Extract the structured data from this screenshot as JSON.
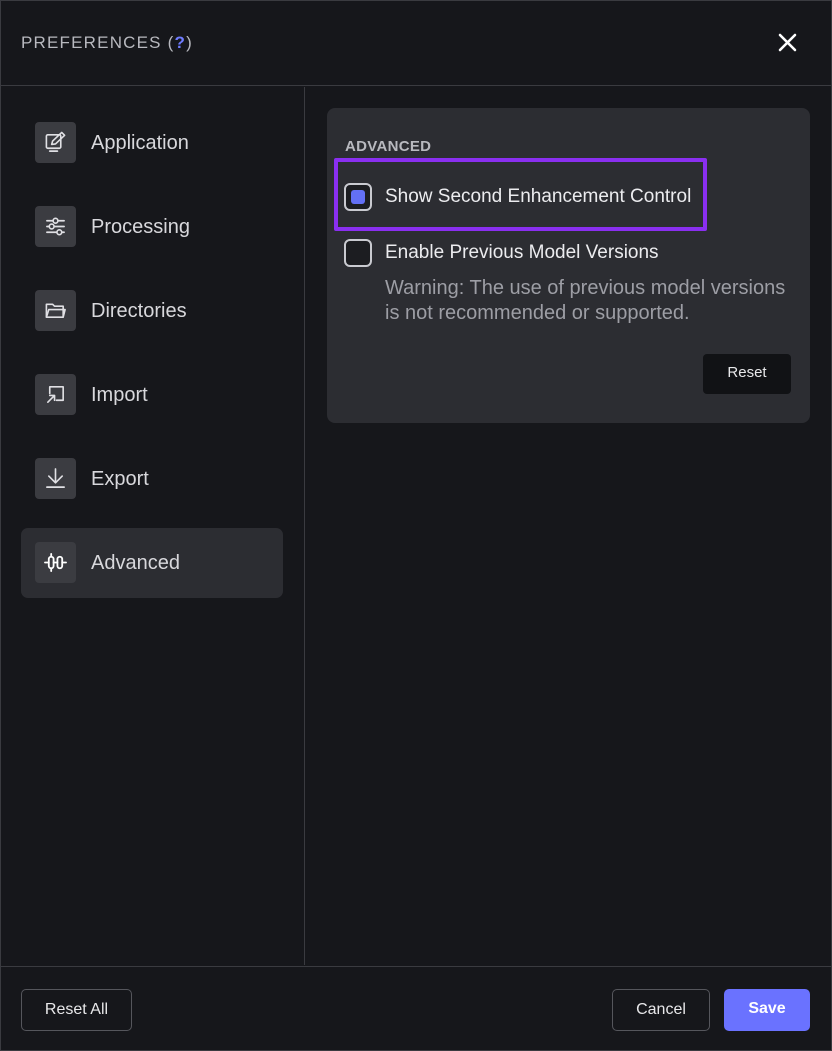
{
  "header": {
    "title": "PREFERENCES",
    "help_open": " (",
    "help_mark": "?",
    "help_close": ")"
  },
  "sidebar": {
    "items": [
      {
        "label": "Application",
        "icon": "application-edit-icon",
        "active": false
      },
      {
        "label": "Processing",
        "icon": "processing-sliders-icon",
        "active": false
      },
      {
        "label": "Directories",
        "icon": "folder-icon",
        "active": false
      },
      {
        "label": "Import",
        "icon": "import-icon",
        "active": false
      },
      {
        "label": "Export",
        "icon": "export-download-icon",
        "active": false
      },
      {
        "label": "Advanced",
        "icon": "advanced-sliders-icon",
        "active": true
      }
    ]
  },
  "panel": {
    "title": "ADVANCED",
    "options": [
      {
        "label": "Show Second Enhancement Control",
        "checked": true
      },
      {
        "label": "Enable Previous Model Versions",
        "checked": false
      }
    ],
    "warning": "Warning: The use of previous model versions is not recommended or supported.",
    "reset_label": "Reset"
  },
  "footer": {
    "reset_all_label": "Reset All",
    "cancel_label": "Cancel",
    "save_label": "Save"
  },
  "colors": {
    "accent": "#6a72ff",
    "checkbox_fill": "#6370f5",
    "highlight": "#8a2ff0",
    "background": "#16171b",
    "panel": "#2c2d32"
  }
}
